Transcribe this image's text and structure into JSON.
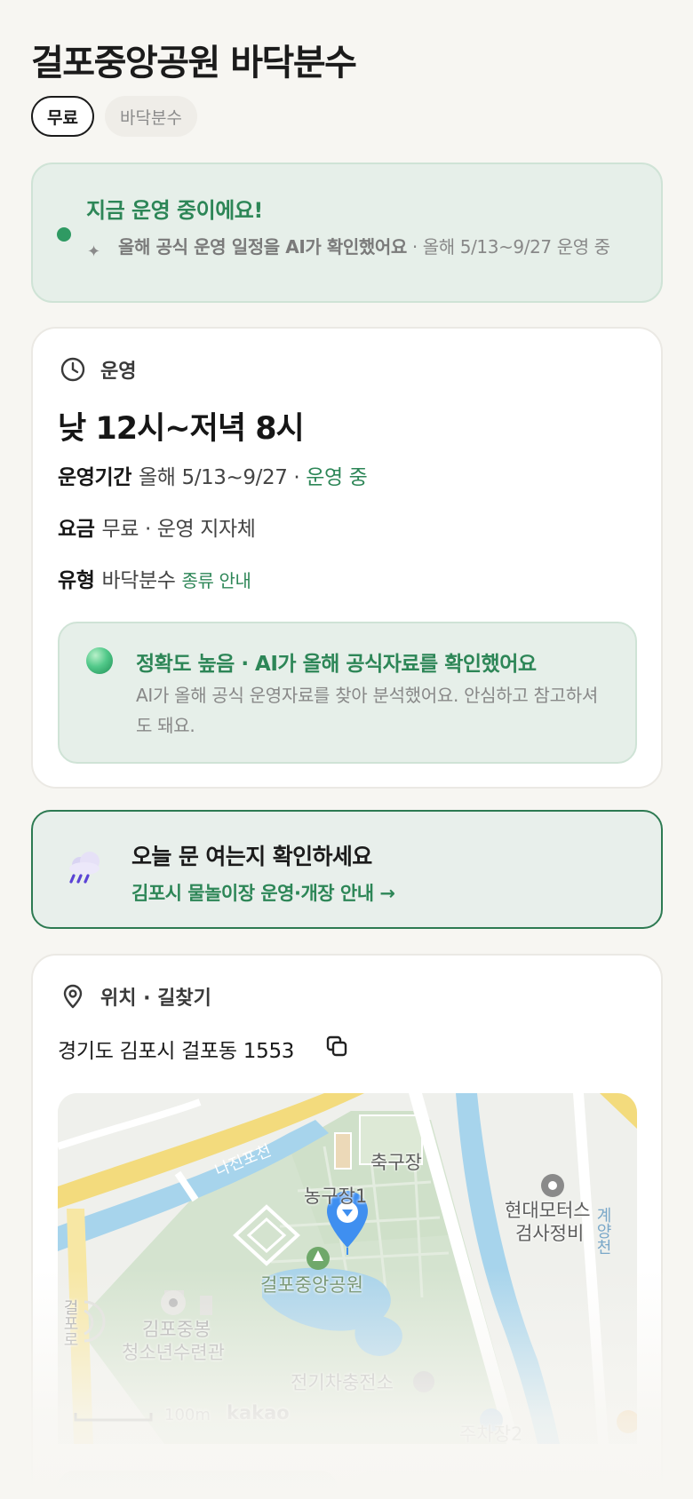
{
  "header": {
    "title": "걸포중앙공원 바닥분수",
    "chips": [
      "무료",
      "바닥분수"
    ]
  },
  "status": {
    "title": "지금 운영 중이에요!",
    "ai_text": "올해 공식 운영 일정을 AI가 확인했어요",
    "detail": " · 올해 5/13~9/27 운영 중",
    "accent_color": "#2d8657"
  },
  "operation": {
    "section_label": "운영",
    "hours": "낮 12시~저녁 8시",
    "period_label": "운영기간",
    "period_value": "올해 5/13~9/27 · ",
    "period_status": "운영 중",
    "fee_label": "요금",
    "fee_value": "무료 · 운영 지자체",
    "type_label": "유형",
    "type_value": "바닥분수",
    "type_link": "종류 안내",
    "accuracy_title": "정확도 높음 · AI가 올해 공식자료를 확인했어요",
    "accuracy_desc": "AI가 올해 공식 운영자료를 찾아 분석했어요. 안심하고 참고하셔도 돼요."
  },
  "notice": {
    "title": "오늘 문 여는지 확인하세요",
    "link": "김포시 물놀이장 운영·개장 안내 →",
    "icon": "rain-cloud-icon"
  },
  "location": {
    "section_label": "위치 · 길찾기",
    "address": "경기도 김포시 걸포동 1553",
    "map": {
      "labels": {
        "stream_a": "나진포천",
        "soccer": "축구장",
        "basketball": "농구장1",
        "park": "걸포중앙공원",
        "motors_1": "현대모터스",
        "motors_2": "검사정비",
        "stream_b": "계양천",
        "youth_1": "김포중봉",
        "youth_2": "청소년수련관",
        "ev": "전기차충전소",
        "road": "걸포로",
        "parking": "주차장2",
        "scale": "100m",
        "brand": "kakao"
      }
    }
  }
}
